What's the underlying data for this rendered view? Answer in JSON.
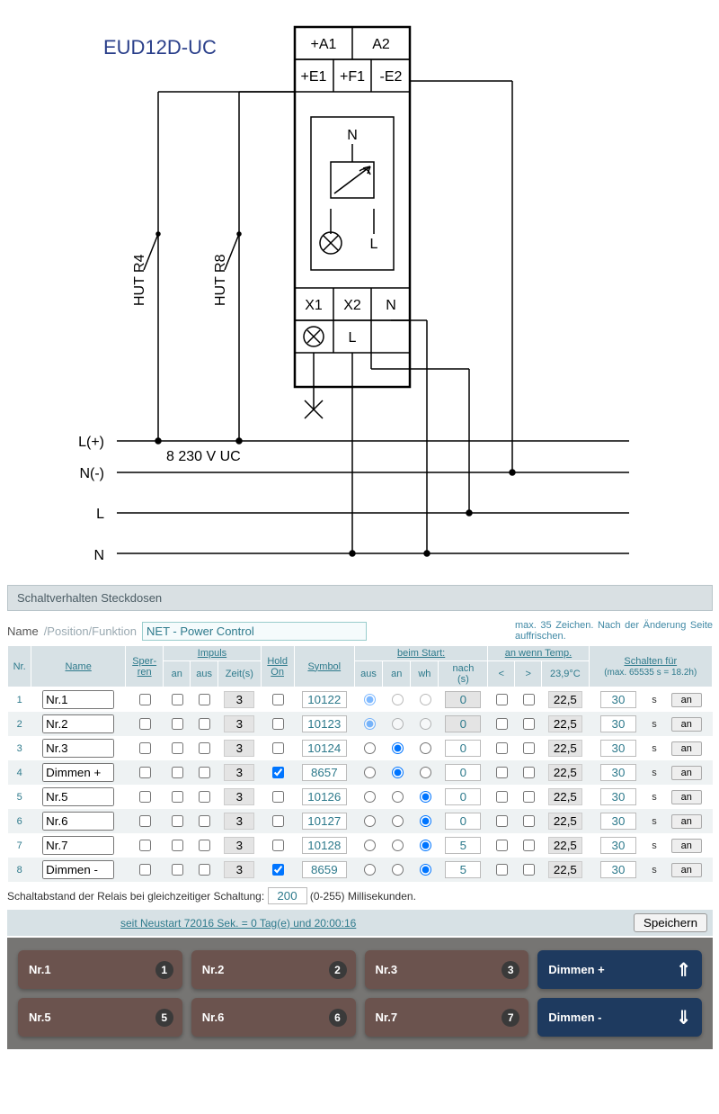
{
  "diagram": {
    "title": "EUD12D-UC",
    "terminals_top1": [
      "+A1",
      "A2"
    ],
    "terminals_top2": [
      "+E1",
      "+F1",
      "-E2"
    ],
    "mid_labels": [
      "N",
      "L"
    ],
    "terminals_bot1": [
      "X1",
      "X2",
      "N"
    ],
    "terminals_bot2": [
      "L"
    ],
    "switch_labels": [
      "HUT R4",
      "HUT R8"
    ],
    "rail_labels": [
      "L(+)",
      "N(-)",
      "L",
      "N"
    ],
    "voltage": "8  230 V UC"
  },
  "panel": {
    "section_title": "Schaltverhalten Steckdosen",
    "name_label": "Name",
    "name_sub": "/Position/Funktion",
    "name_value": "NET - Power Control",
    "name_hint": "max. 35 Zeichen. Nach der Änderung Seite auffrischen.",
    "headers": {
      "nr": "Nr.",
      "name": "Name",
      "sperren": "Sper-\nren",
      "impuls": "Impuls",
      "an": "an",
      "aus": "aus",
      "zeit": "Zeit(s)",
      "holdon": "Hold\nOn",
      "symbol": "Symbol",
      "beimstart": "beim Start:",
      "bs_aus": "aus",
      "bs_an": "an",
      "bs_wh": "wh",
      "nach": "nach\n(s)",
      "temp": "an wenn Temp.",
      "lt": "<",
      "gt": ">",
      "tempval": "23,9°C",
      "schalten": "Schalten für",
      "schalten_sub": "(max. 65535 s = 18.2h)"
    },
    "rows": [
      {
        "nr": 1,
        "name": "Nr.1",
        "zeit": "3",
        "hold": false,
        "symbol": "10122",
        "start": "aus",
        "nach": "0",
        "nach_dis": true,
        "temp": "22,5",
        "schalt": "30"
      },
      {
        "nr": 2,
        "name": "Nr.2",
        "zeit": "3",
        "hold": false,
        "symbol": "10123",
        "start": "aus",
        "nach": "0",
        "nach_dis": true,
        "temp": "22,5",
        "schalt": "30"
      },
      {
        "nr": 3,
        "name": "Nr.3",
        "zeit": "3",
        "hold": false,
        "symbol": "10124",
        "start": "an",
        "nach": "0",
        "nach_dis": false,
        "temp": "22,5",
        "schalt": "30"
      },
      {
        "nr": 4,
        "name": "Dimmen +",
        "zeit": "3",
        "hold": true,
        "symbol": "8657",
        "start": "an",
        "nach": "0",
        "nach_dis": false,
        "temp": "22,5",
        "schalt": "30"
      },
      {
        "nr": 5,
        "name": "Nr.5",
        "zeit": "3",
        "hold": false,
        "symbol": "10126",
        "start": "wh",
        "nach": "0",
        "nach_dis": false,
        "temp": "22,5",
        "schalt": "30"
      },
      {
        "nr": 6,
        "name": "Nr.6",
        "zeit": "3",
        "hold": false,
        "symbol": "10127",
        "start": "wh",
        "nach": "0",
        "nach_dis": false,
        "temp": "22,5",
        "schalt": "30"
      },
      {
        "nr": 7,
        "name": "Nr.7",
        "zeit": "3",
        "hold": false,
        "symbol": "10128",
        "start": "wh",
        "nach": "5",
        "nach_dis": false,
        "temp": "22,5",
        "schalt": "30"
      },
      {
        "nr": 8,
        "name": "Dimmen -",
        "zeit": "3",
        "hold": true,
        "symbol": "8659",
        "start": "wh",
        "nach": "5",
        "nach_dis": false,
        "temp": "22,5",
        "schalt": "30"
      }
    ],
    "unit_s": "s",
    "btn_an": "an",
    "footer_label": "Schaltabstand der Relais bei gleichzeitiger Schaltung:",
    "footer_value": "200",
    "footer_suffix": "(0-255) Millisekunden.",
    "uptime": "seit Neustart 72016 Sek. = 0 Tag(e) und 20:00:16",
    "save": "Speichern"
  },
  "pad": [
    {
      "label": "Nr.1",
      "num": "1",
      "blue": false
    },
    {
      "label": "Nr.2",
      "num": "2",
      "blue": false
    },
    {
      "label": "Nr.3",
      "num": "3",
      "blue": false
    },
    {
      "label": "Dimmen +",
      "arrow": "⇑",
      "blue": true
    },
    {
      "label": "Nr.5",
      "num": "5",
      "blue": false
    },
    {
      "label": "Nr.6",
      "num": "6",
      "blue": false
    },
    {
      "label": "Nr.7",
      "num": "7",
      "blue": false
    },
    {
      "label": "Dimmen -",
      "arrow": "⇓",
      "blue": true
    }
  ]
}
